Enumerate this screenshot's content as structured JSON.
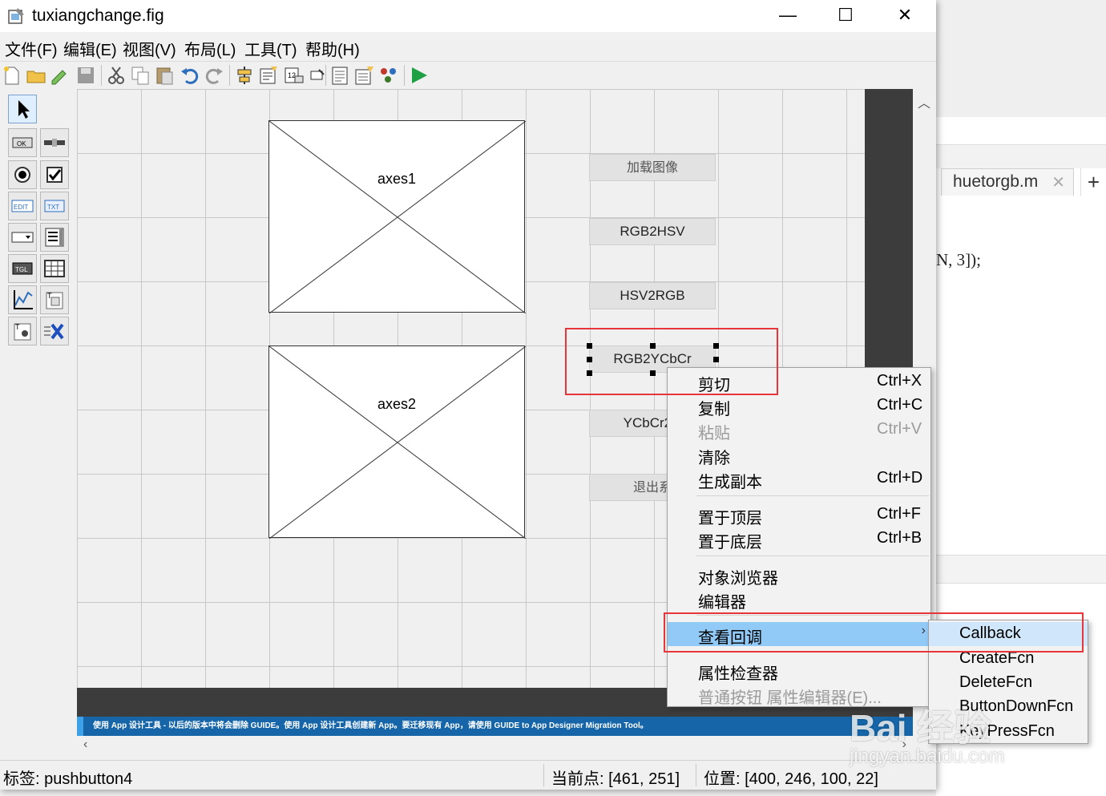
{
  "window": {
    "title": "tuxiangchange.fig"
  },
  "menu": [
    "文件(F)",
    "编辑(E)",
    "视图(V)",
    "布局(L)",
    "工具(T)",
    "帮助(H)"
  ],
  "axes": [
    {
      "label": "axes1"
    },
    {
      "label": "axes2"
    }
  ],
  "buttons": [
    "加载图像",
    "RGB2HSV",
    "HSV2RGB",
    "RGB2YCbCr",
    "YCbCr2R",
    "退出系"
  ],
  "context_menu": {
    "items": [
      {
        "label": "剪切",
        "shortcut": "Ctrl+X"
      },
      {
        "label": "复制",
        "shortcut": "Ctrl+C"
      },
      {
        "label": "粘贴",
        "shortcut": "Ctrl+V"
      },
      {
        "label": "清除",
        "shortcut": ""
      },
      {
        "label": "生成副本",
        "shortcut": "Ctrl+D"
      },
      {
        "label": "置于顶层",
        "shortcut": "Ctrl+F"
      },
      {
        "label": "置于底层",
        "shortcut": "Ctrl+B"
      },
      {
        "label": "对象浏览器",
        "shortcut": ""
      },
      {
        "label": "编辑器",
        "shortcut": ""
      },
      {
        "label": "查看回调",
        "shortcut": ""
      },
      {
        "label": "属性检查器",
        "shortcut": ""
      },
      {
        "label": "普通按钮 属性编辑器(E)...",
        "shortcut": ""
      }
    ]
  },
  "submenu": [
    "Callback",
    "CreateFcn",
    "DeleteFcn",
    "ButtonDownFcn",
    "KeyPressFcn"
  ],
  "info_bar": "使用 App 设计工具 - 以后的版本中将会删除 GUIDE。使用 App 设计工具创建新 App。要迁移现有 App，请使用 GUIDE to App Designer Migration Tool。",
  "status": {
    "tag": "标签: pushbutton4",
    "current_point": "当前点:  [461, 251]",
    "position": "位置: [400, 246, 100, 22]"
  },
  "background_editor": {
    "tab": "huetorgb.m",
    "code": "N, 3]);"
  },
  "watermark": {
    "logo": "Bai 经验",
    "url": "jingyan.baidu.com"
  },
  "colors": {
    "accent": "#91c9f7",
    "highlight_box": "#e8353a",
    "info_bar": "#1565a8"
  }
}
